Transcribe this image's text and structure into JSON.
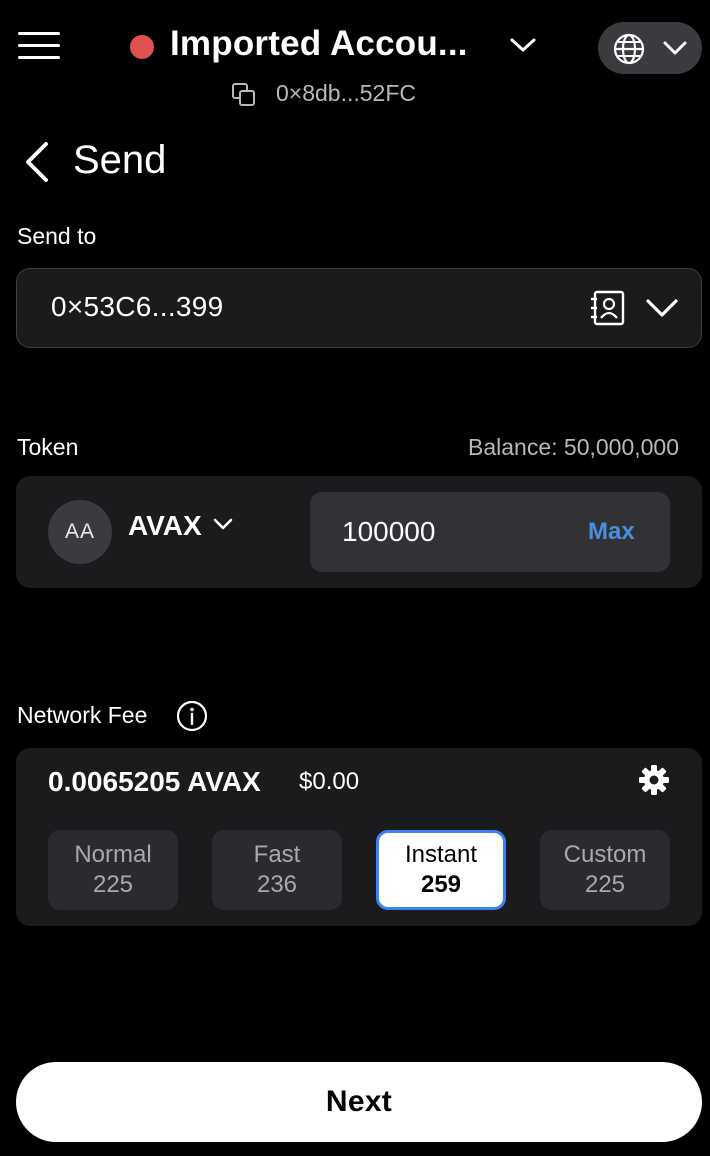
{
  "header": {
    "account_name": "Imported Accou...",
    "account_address": "0×8db...52FC",
    "status_color": "#e05252"
  },
  "page": {
    "title": "Send"
  },
  "send_to": {
    "label": "Send to",
    "address": "0×53C6...399"
  },
  "token": {
    "label": "Token",
    "balance": "Balance: 50,000,000",
    "avatar_initials": "AA",
    "symbol": "AVAX",
    "amount": "100000",
    "max_label": "Max"
  },
  "network_fee": {
    "label": "Network Fee",
    "amount": "0.0065205 AVAX",
    "usd": "$0.00",
    "options": [
      {
        "name": "Normal",
        "value": "225"
      },
      {
        "name": "Fast",
        "value": "236"
      },
      {
        "name": "Instant",
        "value": "259"
      },
      {
        "name": "Custom",
        "value": "225"
      }
    ],
    "selected": "Instant"
  },
  "footer": {
    "next_label": "Next"
  },
  "colors": {
    "background": "#000000",
    "card": "#1b1b1e",
    "accent": "#4a90e2",
    "selected_border": "#3b82f6"
  }
}
